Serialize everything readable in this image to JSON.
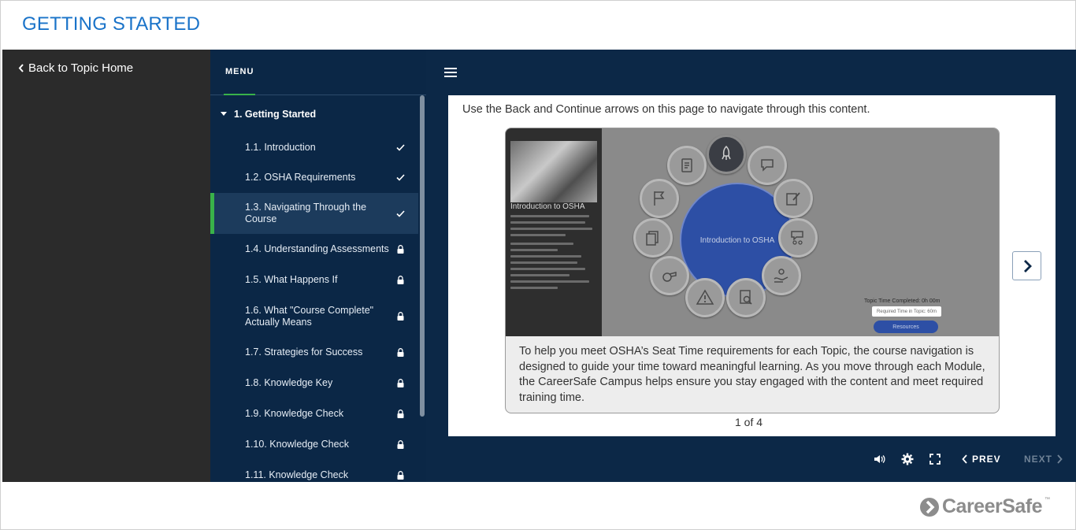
{
  "header": {
    "title": "GETTING STARTED"
  },
  "sidebar": {
    "back_label": "Back to Topic Home"
  },
  "menu": {
    "header": "MENU",
    "section": {
      "label": "1. Getting Started"
    },
    "items": [
      {
        "label": "1.1. Introduction",
        "status": "check-icon"
      },
      {
        "label": "1.2. OSHA Requirements",
        "status": "check-icon"
      },
      {
        "label": "1.3. Navigating Through the Course",
        "status": "check-icon"
      },
      {
        "label": "1.4. Understanding Assessments",
        "status": "lock-icon"
      },
      {
        "label": "1.5. What Happens If",
        "status": "lock-icon"
      },
      {
        "label": "1.6. What \"Course Complete\" Actually Means",
        "status": "lock-icon"
      },
      {
        "label": "1.7. Strategies for Success",
        "status": "lock-icon"
      },
      {
        "label": "1.8. Knowledge Key",
        "status": "lock-icon"
      },
      {
        "label": "1.9. Knowledge Check",
        "status": "lock-icon"
      },
      {
        "label": "1.10. Knowledge Check",
        "status": "lock-icon"
      },
      {
        "label": "1.11. Knowledge Check",
        "status": "lock-icon"
      }
    ],
    "active_item": "1.3. Navigating Through the Course"
  },
  "content": {
    "instructions": "Use the Back and Continue arrows on this page to navigate through this content.",
    "slide": {
      "image_side_heading": "Introduction to OSHA",
      "wheel_center_label": "Introduction to OSHA",
      "topic_time_label": "Topic Time Completed: 0h 00m",
      "required_time_label": "Required Time in Topic: 60m",
      "resources_label": "Resources",
      "caption": "To help you meet OSHA’s Seat Time requirements for each Topic, the course navigation is designed to guide your time toward meaningful learning. As you move through each Module, the CareerSafe Campus helps ensure you stay engaged with the content and meet required training time."
    },
    "pager": "1 of 4"
  },
  "controls": {
    "prev_label": "PREV",
    "next_label": "NEXT"
  },
  "footer": {
    "brand": "CareerSafe",
    "trademark": "™"
  },
  "colors": {
    "accent_blue": "#1a73c9",
    "menu_bg": "#0b2746",
    "content_bg": "#0c2847",
    "active_green": "#39b24a",
    "left_panel_bg": "#2b2b2b"
  }
}
